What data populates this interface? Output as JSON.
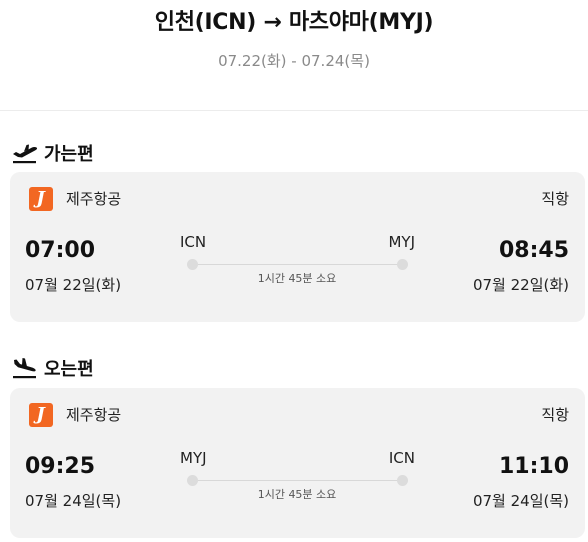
{
  "header": {
    "route_title": "인천(ICN) → 마츠야마(MYJ)",
    "dates": "07.22(화) - 07.24(목)"
  },
  "outbound": {
    "section_label": "가는편",
    "icon": "plane-takeoff-icon",
    "airline": "제주항공",
    "logo_letter": "J",
    "flight_type": "직항",
    "dep_time": "07:00",
    "dep_date": "07월 22일(화)",
    "dep_code": "ICN",
    "arr_code": "MYJ",
    "arr_time": "08:45",
    "arr_date": "07월 22일(화)",
    "duration": "1시간 45분 소요"
  },
  "inbound": {
    "section_label": "오는편",
    "icon": "plane-landing-icon",
    "airline": "제주항공",
    "logo_letter": "J",
    "flight_type": "직항",
    "dep_time": "09:25",
    "dep_date": "07월 24일(목)",
    "dep_code": "MYJ",
    "arr_code": "ICN",
    "arr_time": "11:10",
    "arr_date": "07월 24일(목)",
    "duration": "1시간 45분 소요"
  },
  "colors": {
    "airline_brand": "#f26722",
    "card_bg": "#f2f2f2",
    "muted_text": "#8a8a8a"
  }
}
